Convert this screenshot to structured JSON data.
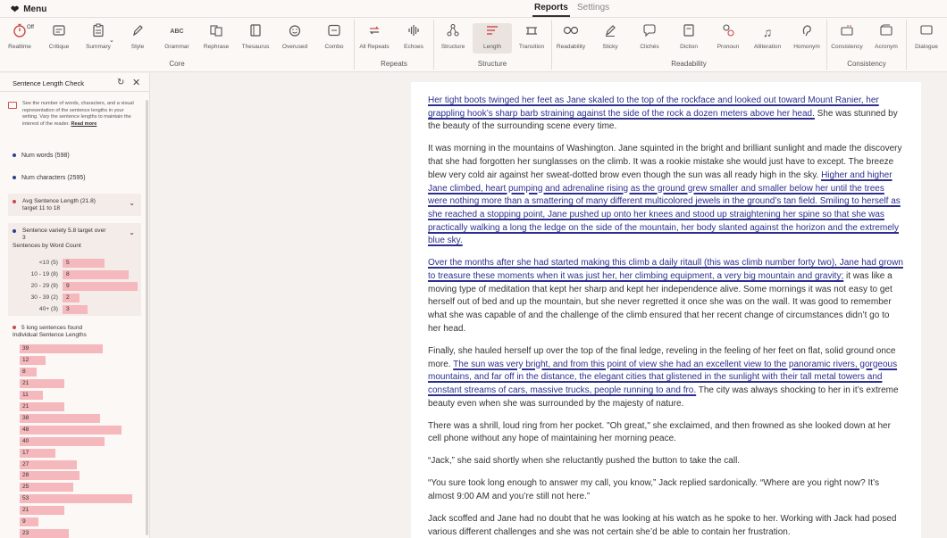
{
  "topbar": {
    "menu_label": "Menu",
    "tabs": [
      {
        "label": "Reports",
        "active": true
      },
      {
        "label": "Settings",
        "active": false
      }
    ]
  },
  "ribbon": {
    "tools": [
      {
        "label": "Realtime",
        "icon": "timer-icon",
        "badge": "Off",
        "group": "Core"
      },
      {
        "label": "Critique",
        "icon": "critique-icon",
        "group": "Core"
      },
      {
        "label": "Summary",
        "icon": "clipboard-icon",
        "group": "Core"
      },
      {
        "label": "Style",
        "icon": "pen-icon",
        "group": "Core"
      },
      {
        "label": "Grammar",
        "icon": "abc-icon",
        "icon_text": "ABC",
        "group": "Core"
      },
      {
        "label": "Rephrase",
        "icon": "rephrase-icon",
        "group": "Core"
      },
      {
        "label": "Thesaurus",
        "icon": "book-icon",
        "group": "Core"
      },
      {
        "label": "Overused",
        "icon": "overused-icon",
        "group": "Core"
      },
      {
        "label": "Combo",
        "icon": "combo-icon",
        "group": "Core"
      },
      {
        "label": "All Repeats",
        "icon": "repeat-icon",
        "group": "Repeats"
      },
      {
        "label": "Echoes",
        "icon": "waveform-icon",
        "group": "Repeats"
      },
      {
        "label": "Structure",
        "icon": "structure-icon",
        "group": "Structure"
      },
      {
        "label": "Length",
        "icon": "length-icon",
        "group": "Structure",
        "selected": true
      },
      {
        "label": "Transition",
        "icon": "transition-icon",
        "group": "Structure"
      },
      {
        "label": "Readability",
        "icon": "glasses-icon",
        "group": "Readability"
      },
      {
        "label": "Sticky",
        "icon": "sticky-icon",
        "group": "Readability"
      },
      {
        "label": "Clichés",
        "icon": "chat-icon",
        "group": "Readability"
      },
      {
        "label": "Diction",
        "icon": "diction-icon",
        "group": "Readability"
      },
      {
        "label": "Pronoun",
        "icon": "pronoun-icon",
        "group": "Readability"
      },
      {
        "label": "Alliteration",
        "icon": "music-icon",
        "group": "Readability"
      },
      {
        "label": "Homonym",
        "icon": "homonym-icon",
        "group": "Readability"
      },
      {
        "label": "Consistency",
        "icon": "consistency-icon",
        "group": "Consistency"
      },
      {
        "label": "Acronym",
        "icon": "acronym-icon",
        "group": "Consistency"
      },
      {
        "label": "Dialogue",
        "icon": "dialogue-icon",
        "group": ""
      }
    ],
    "groups": [
      "Core",
      "Repeats",
      "Structure",
      "Readability",
      "Consistency"
    ]
  },
  "panel": {
    "title": "Sentence Length Check",
    "description": "See the number of words, characters, and a visual representation of the sentence lengths in your writing. Vary the sentence lengths to maintain the interest of the reader.",
    "read_more": "Read more",
    "num_words": "Num words (598)",
    "num_characters": "Num characters (2595)",
    "avg": {
      "line1": "Avg Sentence Length (21.8)",
      "line2": "target 11 to 18"
    },
    "variety": {
      "line1": "Sentence variety 5.8 target over",
      "line2": "3",
      "subtitle": "Sentences by Word Count"
    },
    "distribution": [
      {
        "label": "<10 (5)",
        "value": 5
      },
      {
        "label": "10 - 19 (8)",
        "value": 8
      },
      {
        "label": "20 - 29 (9)",
        "value": 9
      },
      {
        "label": "30 - 39 (2)",
        "value": 2
      },
      {
        "label": "40+ (3)",
        "value": 3
      }
    ],
    "long": {
      "line1": "5 long sentences found",
      "line2": "Individual Sentence Lengths"
    },
    "sentence_lengths": [
      39,
      12,
      8,
      21,
      11,
      21,
      38,
      48,
      40,
      17,
      27,
      28,
      25,
      53,
      21,
      9,
      23
    ],
    "colors": {
      "bar": "#f5b8bc",
      "dot_blue": "#2f3e8a",
      "dot_red": "#c94a4a"
    }
  },
  "document": {
    "paragraphs": [
      [
        {
          "t": "Her tight boots twinged her feet as Jane skaled to the top of the rockface and looked out toward Mount Ranier, her grappling hook’s sharp barb straining against the side of the rock a dozen meters above her head.",
          "hl": true
        },
        {
          "t": " She was stunned by the beauty of the surrounding scene every time.",
          "hl": false
        }
      ],
      [
        {
          "t": "It was morning in the mountains of Washington. Jane squinted in the bright and brilliant sunlight and made the discovery that she had forgotten her sunglasses on the climb. It was a rookie mistake she would just have to except. The breeze blew very cold air against her sweat-dotted brow even though the sun was all ready high in the sky. ",
          "hl": false
        },
        {
          "t": "Higher and higher Jane climbed, heart pumping and adrenaline rising as the ground grew smaller and smaller below her until the trees were nothing more than a smattering of many different multicolored jewels in the ground’s tan field. Smiling to herself as she reached a stopping point, Jane pushed up onto her knees and stood up straightening her spine so that she was practically walking a long the ledge on the side of the mountain, her body slanted against the horizon and the extremely blue sky.",
          "hl": true
        }
      ],
      [
        {
          "t": "Over the months after she had started making this climb a daily ritaull (this was climb number forty two), Jane had grown to treasure these moments when it was just her, her climbing equipment, a very big mountain and gravity;",
          "hl": true
        },
        {
          "t": " it was like a moving type of meditation that kept her sharp and kept her independence alive. Some mornings it was not easy to get herself out of bed and up the mountain, but she never regretted it once she was on the wall. It was good to remember what she was capable of and the challenge of the climb ensured that her recent change of circumstances didn’t go to her head.",
          "hl": false
        }
      ],
      [
        {
          "t": "Finally, she hauled herself up over the top of the final ledge, reveling in the feeling of her feet on flat, solid ground once more. ",
          "hl": false
        },
        {
          "t": "The sun was very bright, and from this point of view she had an excellent view to the panoramic rivers, gorgeous mountains, and far off in the distance, the elegant cities that glistened in the sunlight with their tall metal towers and constant streams of cars, massive trucks, people running to and fro.",
          "hl": true
        },
        {
          "t": " The city was always shocking to her in it’s extreme beauty even when she was surrounded by the majesty of nature.",
          "hl": false
        }
      ],
      [
        {
          "t": "There was a shrill, loud ring from her pocket. \"Oh great,\" she exclaimed, and then frowned as she looked down at her cell phone without any hope of maintaining her morning peace.",
          "hl": false
        }
      ],
      [
        {
          "t": "“Jack,” she said shortly when she reluctantly pushed the button to take the call.",
          "hl": false
        }
      ],
      [
        {
          "t": "“You sure took long enough to answer my call, you know,” Jack replied sardonically. “Where are you right now? It’s almost 9:00 AM and you’re still not here.”",
          "hl": false
        }
      ],
      [
        {
          "t": "Jack scoffed and Jane had no doubt that he was looking at his watch as he spoke to her. Working with Jack had posed various different challenges and she was not certain she’d be able to contain her frustration.",
          "hl": false
        }
      ]
    ]
  }
}
